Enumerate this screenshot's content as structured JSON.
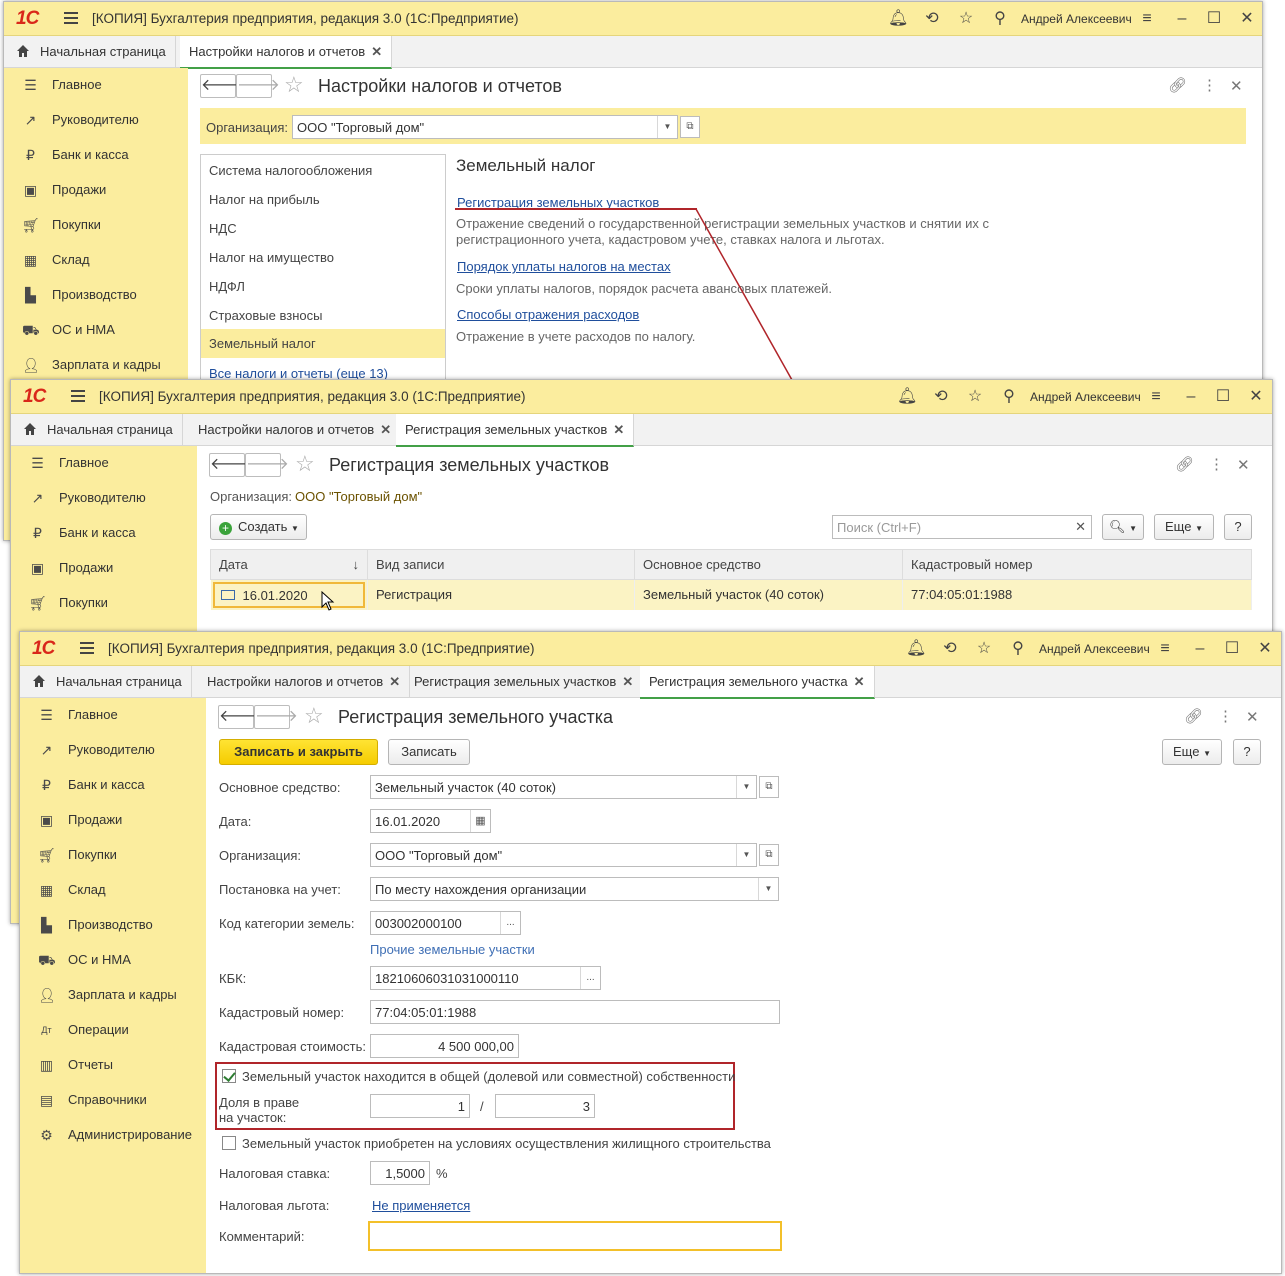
{
  "app": {
    "window_title": "[КОПИЯ] Бухгалтерия предприятия, редакция 3.0  (1С:Предприятие)",
    "user": "Андрей Алексеевич",
    "logo": "1С"
  },
  "sidebar": {
    "items": [
      "Главное",
      "Руководителю",
      "Банк и касса",
      "Продажи",
      "Покупки",
      "Склад",
      "Производство",
      "ОС и НМА",
      "Зарплата и кадры",
      "Операции",
      "Отчеты",
      "Справочники",
      "Администрирование"
    ]
  },
  "tabs": {
    "home": "Начальная страница",
    "tax_settings": "Настройки налогов и отчетов",
    "land_registrations": "Регистрация земельных участков",
    "land_registration": "Регистрация земельного участка",
    "close": "✕"
  },
  "w1": {
    "title": "Настройки налогов и отчетов",
    "org_label": "Организация:",
    "org_value": "ООО \"Торговый дом\"",
    "menu": [
      "Система налогообложения",
      "Налог на прибыль",
      "НДС",
      "Налог на имущество",
      "НДФЛ",
      "Страховые взносы",
      "Земельный налог"
    ],
    "menu_all": "Все налоги и отчеты (еще 13)",
    "section_title": "Земельный налог",
    "link1": "Регистрация земельных участков",
    "desc1": "Отражение сведений о государственной регистрации земельных участков и снятии их с регистрационного учета, кадастровом учете, ставках налога и льготах.",
    "link2": "Порядок уплаты налогов на местах",
    "desc2": "Сроки уплаты налогов, порядок расчета авансовых платежей.",
    "link3": "Способы отражения расходов",
    "desc3": "Отражение в учете расходов по налогу."
  },
  "w2": {
    "title": "Регистрация земельных участков",
    "org_label": "Организация:",
    "org_value": "ООО \"Торговый дом\"",
    "create_btn": "Создать",
    "search_placeholder": "Поиск (Ctrl+F)",
    "more_btn": "Еще",
    "help_btn": "?",
    "columns": [
      "Дата",
      "Вид записи",
      "Основное средство",
      "Кадастровый номер"
    ],
    "row": {
      "date": "16.01.2020",
      "type": "Регистрация",
      "asset": "Земельный участок (40 соток)",
      "cadastral": "77:04:05:01:1988"
    }
  },
  "w3": {
    "title": "Регистрация земельного участка",
    "save_close_btn": "Записать и закрыть",
    "save_btn": "Записать",
    "more_btn": "Еще",
    "help_btn": "?",
    "asset_label": "Основное средство:",
    "asset_value": "Земельный участок (40 соток)",
    "date_label": "Дата:",
    "date_value": "16.01.2020",
    "org_label": "Организация:",
    "org_value": "ООО \"Торговый дом\"",
    "registration_label": "Постановка на учет:",
    "registration_value": "По месту нахождения организации",
    "category_label": "Код категории земель:",
    "category_value": "003002000100",
    "category_hint": "Прочие земельные участки",
    "kbk_label": "КБК:",
    "kbk_value": "18210606031031000110",
    "cadastral_label": "Кадастровый номер:",
    "cadastral_value": "77:04:05:01:1988",
    "cost_label": "Кадастровая стоимость:",
    "cost_value": "4 500 000,00",
    "shared_label": "Земельный участок находится в общей (долевой или совместной) собственности",
    "shared_checked": true,
    "share_label_1": "Доля в праве",
    "share_label_2": "на участок:",
    "share_num": "1",
    "share_sep": "/",
    "share_den": "3",
    "housing_label": "Земельный участок приобретен на условиях осуществления жилищного строительства",
    "housing_checked": false,
    "rate_label": "Налоговая ставка:",
    "rate_value": "1,5000",
    "rate_unit": "%",
    "benefit_label": "Налоговая льгота:",
    "benefit_value": "Не применяется",
    "comment_label": "Комментарий:",
    "comment_value": "",
    "ellipsis": "..."
  },
  "colors": {
    "accent_yellow": "#fbed9e",
    "annotation_red": "#b0252a",
    "active_green": "#43a047"
  }
}
